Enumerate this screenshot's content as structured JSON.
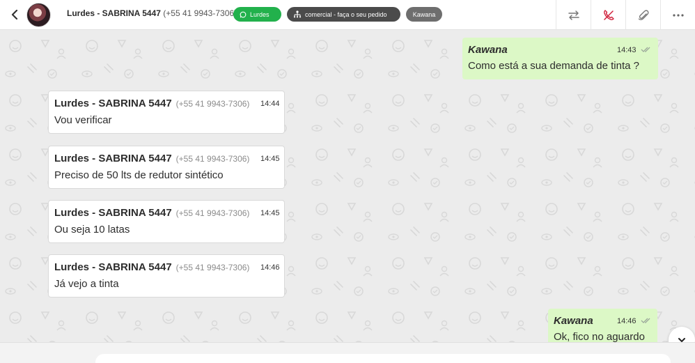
{
  "header": {
    "contact_name": "Lurdes - SABRINA 5447",
    "contact_phone": "(+55 41 9943-7306)",
    "tags": {
      "whatsapp": "Lurdes",
      "queue": "comercial - faça o seu pedido",
      "user": "Kawana"
    },
    "icons": [
      "back-chevron-icon",
      "transfer-icon",
      "end-call-icon",
      "attach-icon",
      "more-icon"
    ]
  },
  "messages": [
    {
      "direction": "out",
      "sender": "Kawana",
      "time": "14:43",
      "text": "Como está a sua demanda de tinta ?"
    },
    {
      "direction": "in",
      "sender": "Lurdes - SABRINA 5447",
      "phone": "(+55 41 9943-7306)",
      "time": "14:44",
      "text": "Vou verificar"
    },
    {
      "direction": "in",
      "sender": "Lurdes - SABRINA 5447",
      "phone": "(+55 41 9943-7306)",
      "time": "14:45",
      "text": "Preciso de 50 lts de redutor sintético"
    },
    {
      "direction": "in",
      "sender": "Lurdes - SABRINA 5447",
      "phone": "(+55 41 9943-7306)",
      "time": "14:45",
      "text": "Ou seja 10 latas"
    },
    {
      "direction": "in",
      "sender": "Lurdes - SABRINA 5447",
      "phone": "(+55 41 9943-7306)",
      "time": "14:46",
      "text": "Já vejo a tinta"
    },
    {
      "direction": "out",
      "sender": "Kawana",
      "time": "14:46",
      "text": "Ok, fico no aguardo"
    }
  ],
  "composer": {
    "placeholder": ""
  },
  "colors": {
    "outgoing_bubble": "#dcf8c6",
    "incoming_bubble": "#ffffff",
    "chat_background": "#ececec",
    "tag_whatsapp": "#22b14c",
    "tag_queue": "#4b4b4b",
    "tag_user": "#6e6e6e",
    "end_call": "#d0213b"
  }
}
